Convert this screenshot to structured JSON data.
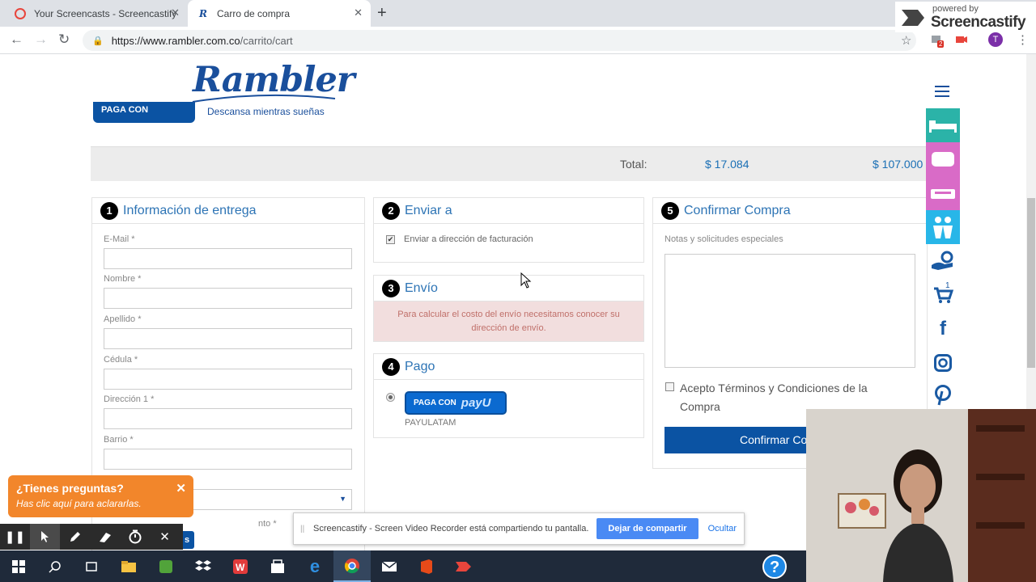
{
  "browser": {
    "tabs": [
      {
        "title": "Your Screencasts - Screencastify",
        "active": false
      },
      {
        "title": "Carro de compra",
        "active": true
      }
    ],
    "url_host": "https://www.rambler.com.co",
    "url_path": "/carrito/cart",
    "extension_badge": "2"
  },
  "screencastify_badge": {
    "powered": "powered by",
    "name": "Screencastify"
  },
  "site": {
    "brand": "Rambler",
    "tagline": "Descansa mientras sueñas",
    "payu_top_label": "PAGA CON"
  },
  "totals": {
    "label": "Total:",
    "value1": "$ 17.084",
    "value2": "$ 107.000"
  },
  "delivery": {
    "number": "1",
    "title": "Información de entrega",
    "fields": [
      {
        "label": "E-Mail *"
      },
      {
        "label": "Nombre *"
      },
      {
        "label": "Apellido *"
      },
      {
        "label": "Cédula *"
      },
      {
        "label": "Dirección 1 *"
      },
      {
        "label": "Barrio *"
      }
    ],
    "partial_label": "nto *"
  },
  "ship_to": {
    "number": "2",
    "title": "Enviar a",
    "checkbox_label": "Enviar a dirección de facturación",
    "checked": true
  },
  "shipping": {
    "number": "3",
    "title": "Envío",
    "alert": "Para calcular el costo del envío necesitamos conocer su dirección de envío."
  },
  "payment": {
    "number": "4",
    "title": "Pago",
    "button_label": "PAGA CON",
    "payu": "payU",
    "method_name": "PAYULATAM"
  },
  "confirm": {
    "number": "5",
    "title": "Confirmar Compra",
    "notes_label": "Notas y solicitudes especiales",
    "terms_label": "Acepto Términos y Condiciones de la Compra",
    "button_label": "Confirmar Co"
  },
  "cart_count": "1",
  "chat": {
    "title": "¿Tienes preguntas?",
    "subtitle": "Has clic aquí para aclararlas."
  },
  "share_bar": {
    "message": "Screencastify - Screen Video Recorder está compartiendo tu pantalla.",
    "stop_label": "Dejar de compartir",
    "hide_label": "Ocultar"
  },
  "colors": {
    "brand": "#1a4f9c",
    "accent": "#2d74b5",
    "chat": "#f2862b",
    "alert_bg": "#f2dede",
    "alert_text": "#a94442"
  }
}
